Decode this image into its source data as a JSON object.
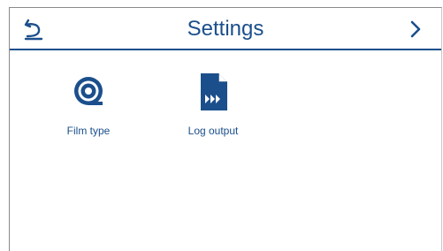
{
  "header": {
    "title": "Settings",
    "back_icon": "back-arrow-icon",
    "next_icon": "chevron-right-icon"
  },
  "tiles": [
    {
      "label": "Film type",
      "icon": "film-type-icon"
    },
    {
      "label": "Log output",
      "icon": "log-file-icon"
    }
  ],
  "colors": {
    "accent": "#1b4f8c",
    "background": "#ffffff"
  }
}
